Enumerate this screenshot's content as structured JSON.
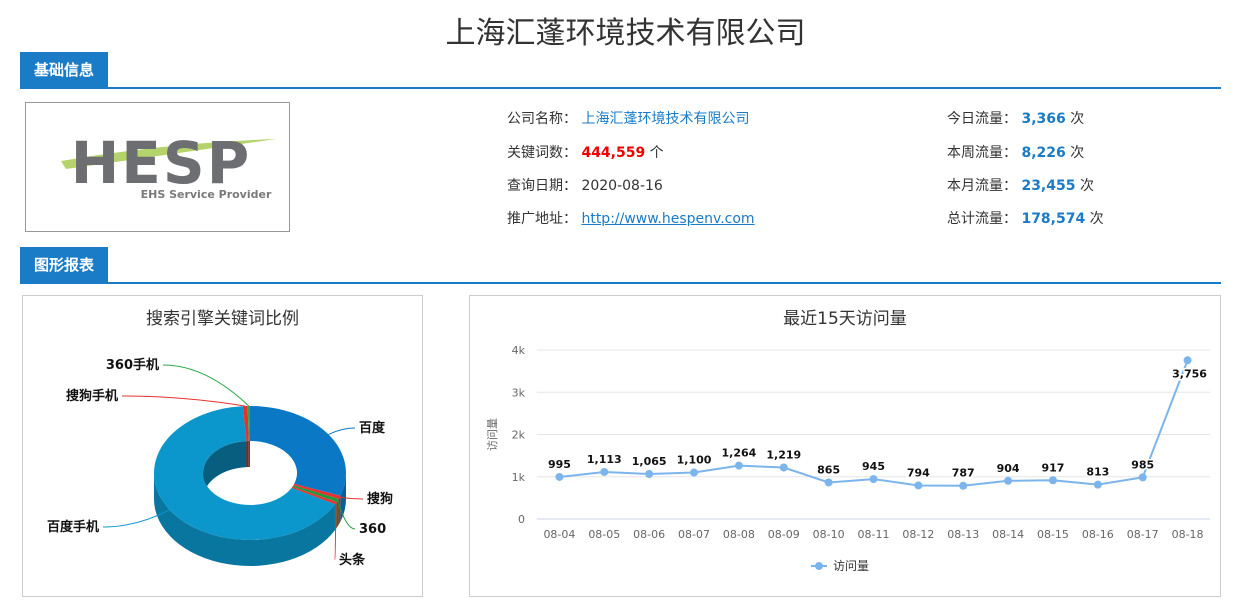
{
  "page": {
    "title": "上海汇蓬环境技术有限公司"
  },
  "sections": {
    "basic_info": "基础信息",
    "charts": "图形报表"
  },
  "logo": {
    "text": "HESP",
    "subtext": "EHS Service Provider",
    "colors": {
      "letters": "#6d6e71",
      "swoosh": "#b5d36b",
      "subtext": "#7a7a7a"
    }
  },
  "info": {
    "company_name_label": "公司名称：",
    "company_name": "上海汇蓬环境技术有限公司",
    "keywords_label": "关键词数：",
    "keywords_value": "444,559",
    "keywords_unit": "个",
    "query_date_label": "查询日期：",
    "query_date": "2020-08-16",
    "promo_url_label": "推广地址：",
    "promo_url": "http://www.hespenv.com",
    "today_label": "今日流量：",
    "today_value": "3,366",
    "week_label": "本周流量：",
    "week_value": "8,226",
    "month_label": "本月流量：",
    "month_value": "23,455",
    "total_label": "总计流量：",
    "total_value": "178,574",
    "unit_times": "次"
  },
  "colors": {
    "accent": "#1a7bc6",
    "red_value": "#e00000",
    "line": "#7cb5ec"
  },
  "chart_data": [
    {
      "type": "pie",
      "title": "搜索引擎关键词比例",
      "variant": "3d-donut",
      "slices": [
        {
          "label": "百度",
          "value": 30.5,
          "color": "#0b78c6"
        },
        {
          "label": "搜狗",
          "value": 0.8,
          "color": "#e8312f"
        },
        {
          "label": "360",
          "value": 0.8,
          "color": "#1f9a3a"
        },
        {
          "label": "头条",
          "value": 0.6,
          "color": "#e8312f"
        },
        {
          "label": "百度手机",
          "value": 66.1,
          "color": "#0c97cc"
        },
        {
          "label": "搜狗手机",
          "value": 0.8,
          "color": "#e8312f"
        },
        {
          "label": "360手机",
          "value": 0.4,
          "color": "#2ea84a"
        }
      ]
    },
    {
      "type": "line",
      "title": "最近15天访问量",
      "ylabel": "访问量",
      "categories": [
        "08-04",
        "08-05",
        "08-06",
        "08-07",
        "08-08",
        "08-09",
        "08-10",
        "08-11",
        "08-12",
        "08-13",
        "08-14",
        "08-15",
        "08-16",
        "08-17",
        "08-18"
      ],
      "series": [
        {
          "name": "访问量",
          "values": [
            995,
            1113,
            1065,
            1100,
            1264,
            1219,
            865,
            945,
            794,
            787,
            904,
            917,
            813,
            985,
            3756
          ]
        }
      ],
      "data_labels": [
        "995",
        "1,113",
        "1,065",
        "1,100",
        "1,264",
        "1,219",
        "865",
        "945",
        "794",
        "787",
        "904",
        "917",
        "813",
        "985",
        "3,756"
      ],
      "ylim": [
        0,
        4000
      ],
      "yticks": [
        0,
        1000,
        2000,
        3000,
        4000
      ],
      "ytick_labels": [
        "0",
        "1k",
        "2k",
        "3k",
        "4k"
      ],
      "grid": true,
      "legend": "bottom-center"
    }
  ]
}
